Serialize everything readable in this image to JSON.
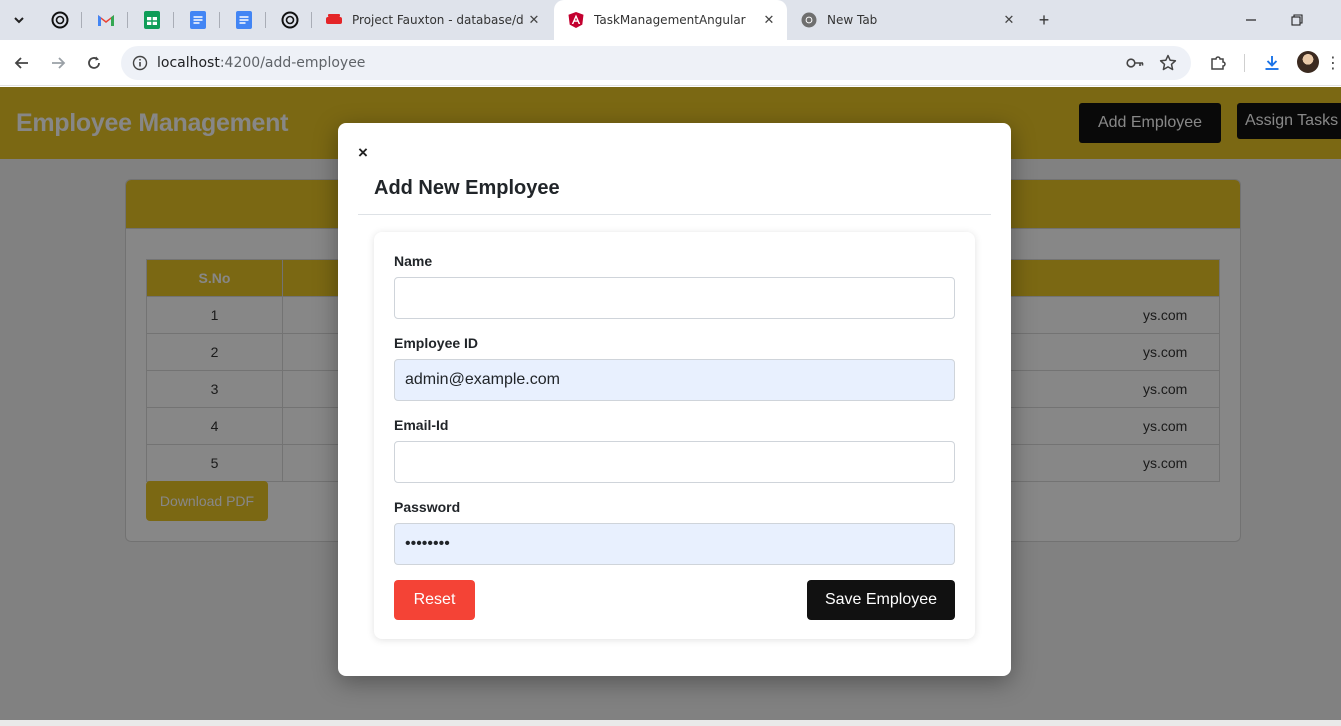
{
  "browser": {
    "tabs": [
      {
        "title": "Project Fauxton - database/den",
        "icon": "couchdb-icon",
        "active": false
      },
      {
        "title": "TaskManagementAngular",
        "icon": "angular-icon",
        "active": true
      },
      {
        "title": "New Tab",
        "icon": "chrome-icon",
        "active": false
      }
    ],
    "pinned_icons": [
      "openai-icon",
      "gmail-icon",
      "sheets-icon",
      "docs-icon",
      "docs-icon",
      "openai-icon"
    ],
    "url_host": "localhost",
    "url_path": ":4200/add-employee"
  },
  "app": {
    "title": "Employee Management",
    "add_employee_label": "Add Employee",
    "assign_tasks_label": "Assign Tasks"
  },
  "table": {
    "sno_header": "S.No",
    "rows": [
      {
        "sno": "1",
        "email_tail": "ys.com"
      },
      {
        "sno": "2",
        "email_tail": "ys.com"
      },
      {
        "sno": "3",
        "email_tail": "ys.com"
      },
      {
        "sno": "4",
        "email_tail": "ys.com"
      },
      {
        "sno": "5",
        "email_tail": "ys.com"
      }
    ],
    "download_pdf_label": "Download PDF"
  },
  "modal": {
    "close_glyph": "×",
    "title": "Add New Employee",
    "fields": {
      "name_label": "Name",
      "name_value": "",
      "employee_id_label": "Employee ID",
      "employee_id_value": "admin@example.com",
      "email_label": "Email-Id",
      "email_value": "",
      "password_label": "Password",
      "password_value": "adminpwd"
    },
    "reset_label": "Reset",
    "save_label": "Save Employee"
  },
  "colors": {
    "brand_yellow": "#e8c425",
    "dark_button": "#111111",
    "reset_red": "#f44336",
    "autofill_blue": "#e8f0fe"
  }
}
